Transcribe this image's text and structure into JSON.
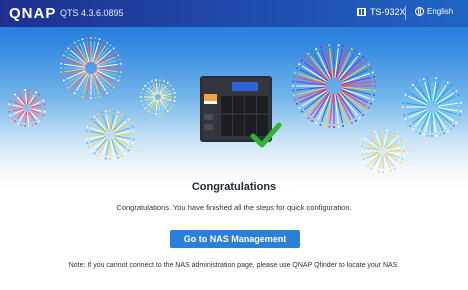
{
  "header": {
    "logo": "QNAP",
    "version": "QTS 4.3.6.0895",
    "model": "TS-932X",
    "language": "English"
  },
  "main": {
    "title": "Congratulations",
    "message": "Congratulations. You have finished all the steps for quick configuration.",
    "button_label": "Go to NAS Management",
    "note": "Note: If you cannot connect to the NAS administration page, please use QNAP Qfinder to locate your NAS."
  },
  "colors": {
    "accent": "#2b7fd8",
    "check": "#2fb52f",
    "header": "#1f3f9f"
  }
}
